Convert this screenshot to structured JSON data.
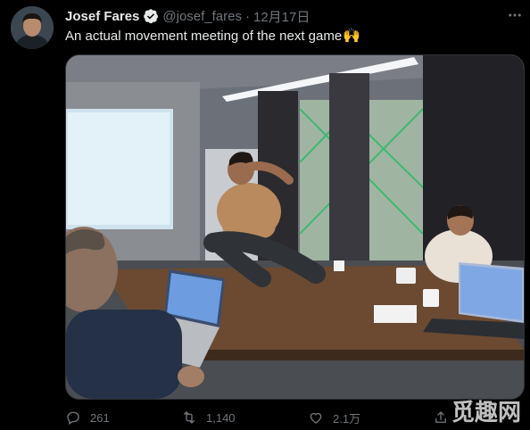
{
  "tweet": {
    "author_name": "Josef Fares",
    "handle": "@josef_fares",
    "separator": "·",
    "date": "12月17日",
    "text": "An actual movement meeting of the next game",
    "emoji": "🙌",
    "verified": true
  },
  "actions": {
    "reply_count": "261",
    "retweet_count": "1,140",
    "like_count": "2.1万"
  },
  "icons": {
    "more": "more-icon",
    "reply": "reply-icon",
    "retweet": "retweet-icon",
    "like": "like-icon",
    "share": "share-icon",
    "verified": "verified-badge-icon"
  },
  "watermark": "觅趣网",
  "colors": {
    "background": "#000000",
    "text": "#e7e9ea",
    "secondary": "#71767b",
    "verified": "#1d9bf0"
  }
}
